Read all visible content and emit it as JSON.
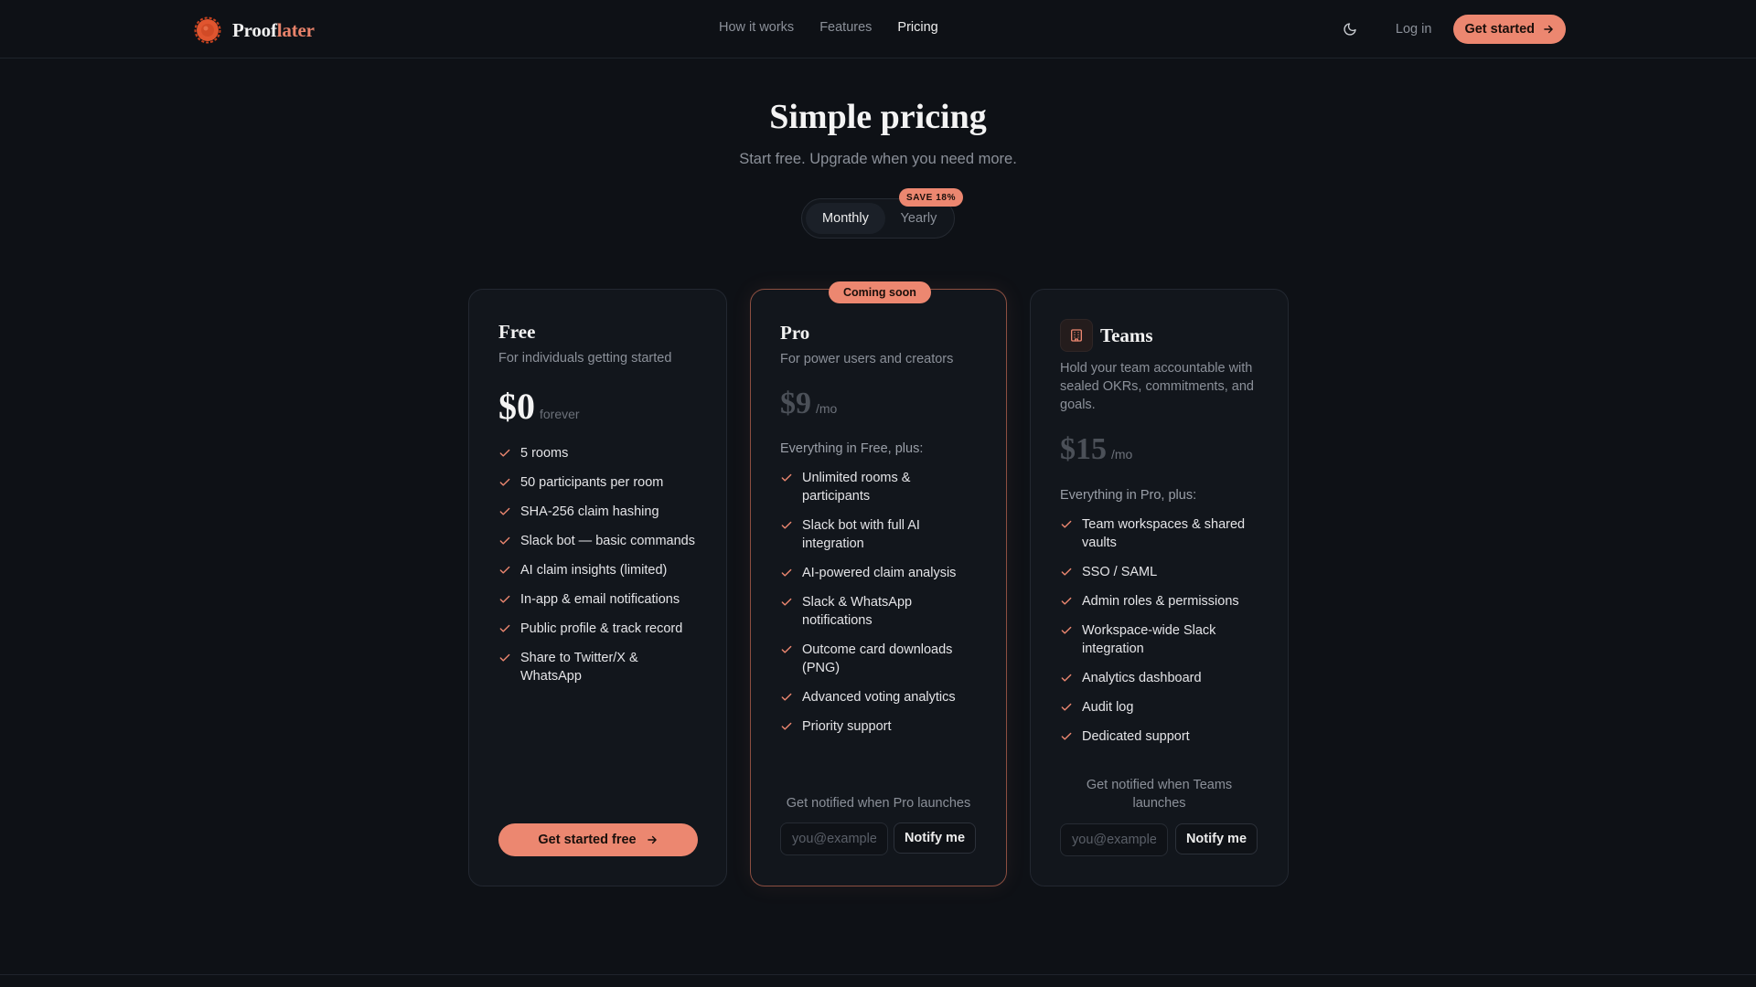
{
  "brand": {
    "name_prefix": "Proof",
    "name_suffix": "later",
    "accent_color": "#ec8770"
  },
  "nav": {
    "items": [
      "How it works",
      "Features",
      "Pricing"
    ],
    "active": "Pricing"
  },
  "header": {
    "login_label": "Log in",
    "cta_label": "Get started"
  },
  "hero": {
    "title": "Simple pricing",
    "subtitle": "Start free. Upgrade when you need more."
  },
  "billing_toggle": {
    "monthly_label": "Monthly",
    "yearly_label": "Yearly",
    "save_badge": "SAVE 18%",
    "selected": "Monthly"
  },
  "plans": {
    "free": {
      "name": "Free",
      "description": "For individuals getting started",
      "price": "$0",
      "period": "forever",
      "features": [
        "5 rooms",
        "50 participants per room",
        "SHA-256 claim hashing",
        "Slack bot — basic commands",
        "AI claim insights (limited)",
        "In-app & email notifications",
        "Public profile & track record",
        "Share to Twitter/X & WhatsApp"
      ],
      "cta_label": "Get started free"
    },
    "pro": {
      "badge": "Coming soon",
      "name": "Pro",
      "description": "For power users and creators",
      "price": "$9",
      "period": "/mo",
      "intro": "Everything in Free, plus:",
      "features": [
        "Unlimited rooms & participants",
        "Slack bot with full AI integration",
        "AI-powered claim analysis",
        "Slack & WhatsApp notifications",
        "Outcome card downloads (PNG)",
        "Advanced voting analytics",
        "Priority support"
      ],
      "notify_text": "Get notified when Pro launches",
      "email_placeholder": "you@example.com",
      "notify_label": "Notify me"
    },
    "teams": {
      "name": "Teams",
      "description": "Hold your team accountable with sealed OKRs, commitments, and goals.",
      "price": "$15",
      "period": "/mo",
      "intro": "Everything in Pro, plus:",
      "features": [
        "Team workspaces & shared vaults",
        "SSO / SAML",
        "Admin roles & permissions",
        "Workspace-wide Slack integration",
        "Analytics dashboard",
        "Audit log",
        "Dedicated support"
      ],
      "notify_text": "Get notified when Teams launches",
      "email_placeholder": "you@example.com",
      "notify_label": "Notify me"
    }
  }
}
